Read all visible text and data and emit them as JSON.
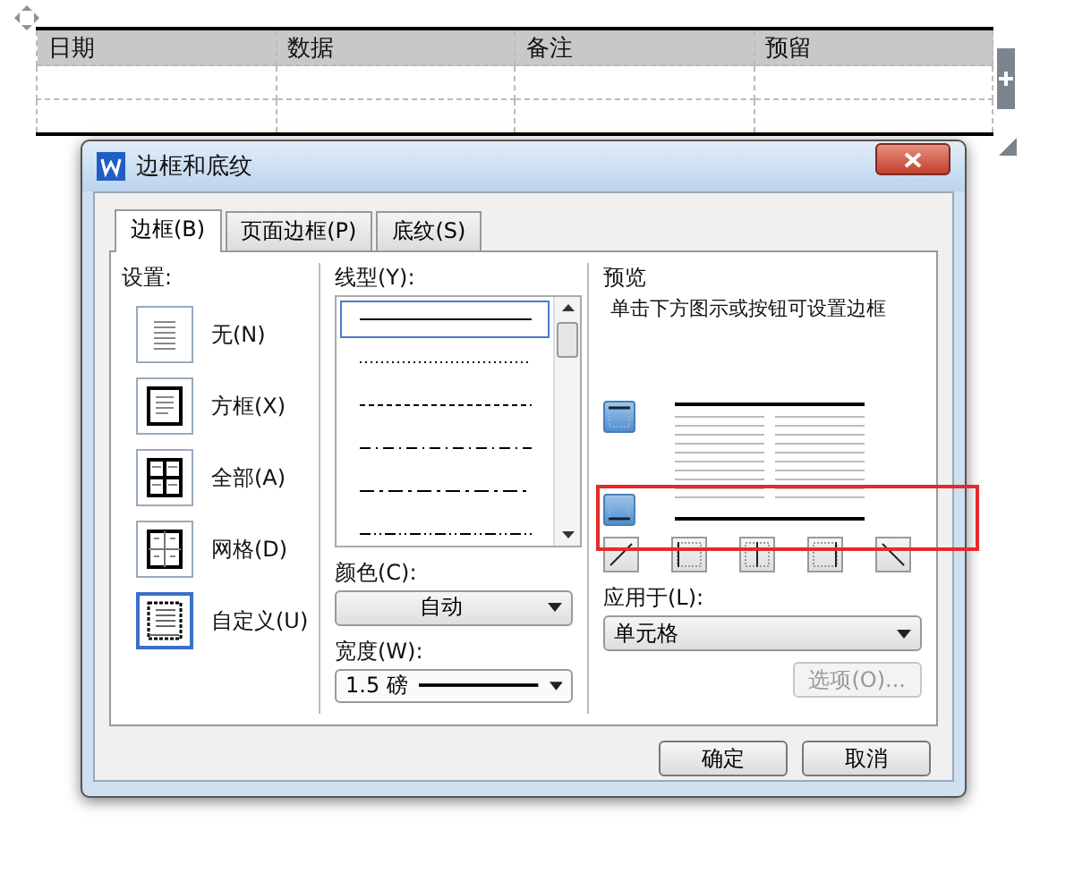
{
  "table": {
    "columns": [
      "日期",
      "数据",
      "备注",
      "预留"
    ]
  },
  "dialog": {
    "title": "边框和底纹",
    "tabs": [
      {
        "label": "边框(B)",
        "selected": true
      },
      {
        "label": "页面边框(P)",
        "selected": false
      },
      {
        "label": "底纹(S)",
        "selected": false
      }
    ],
    "settings": {
      "label": "设置:",
      "items": [
        {
          "kind": "none",
          "label": "无(N)",
          "selected": false
        },
        {
          "kind": "box",
          "label": "方框(X)",
          "selected": false
        },
        {
          "kind": "all",
          "label": "全部(A)",
          "selected": false
        },
        {
          "kind": "grid",
          "label": "网格(D)",
          "selected": false
        },
        {
          "kind": "custom",
          "label": "自定义(U)",
          "selected": true
        }
      ]
    },
    "line_style": {
      "label": "线型(Y):",
      "items": [
        {
          "kind": "solid",
          "selected": true
        },
        {
          "kind": "dotted",
          "selected": false
        },
        {
          "kind": "dashed",
          "selected": false
        },
        {
          "kind": "dash-dot",
          "selected": false
        },
        {
          "kind": "long-dash-dot",
          "selected": false
        },
        {
          "kind": "dash-dot-dot",
          "selected": false
        }
      ]
    },
    "color": {
      "label": "颜色(C):",
      "value": "自动"
    },
    "width": {
      "label": "宽度(W):",
      "value": "1.5 磅"
    },
    "preview": {
      "label": "预览",
      "hint": "单击下方图示或按钮可设置边框"
    },
    "apply_to": {
      "label": "应用于(L):",
      "value": "单元格"
    },
    "options_button": {
      "label": "选项(O)...",
      "disabled": true
    },
    "buttons": [
      "确定",
      "取消"
    ]
  }
}
